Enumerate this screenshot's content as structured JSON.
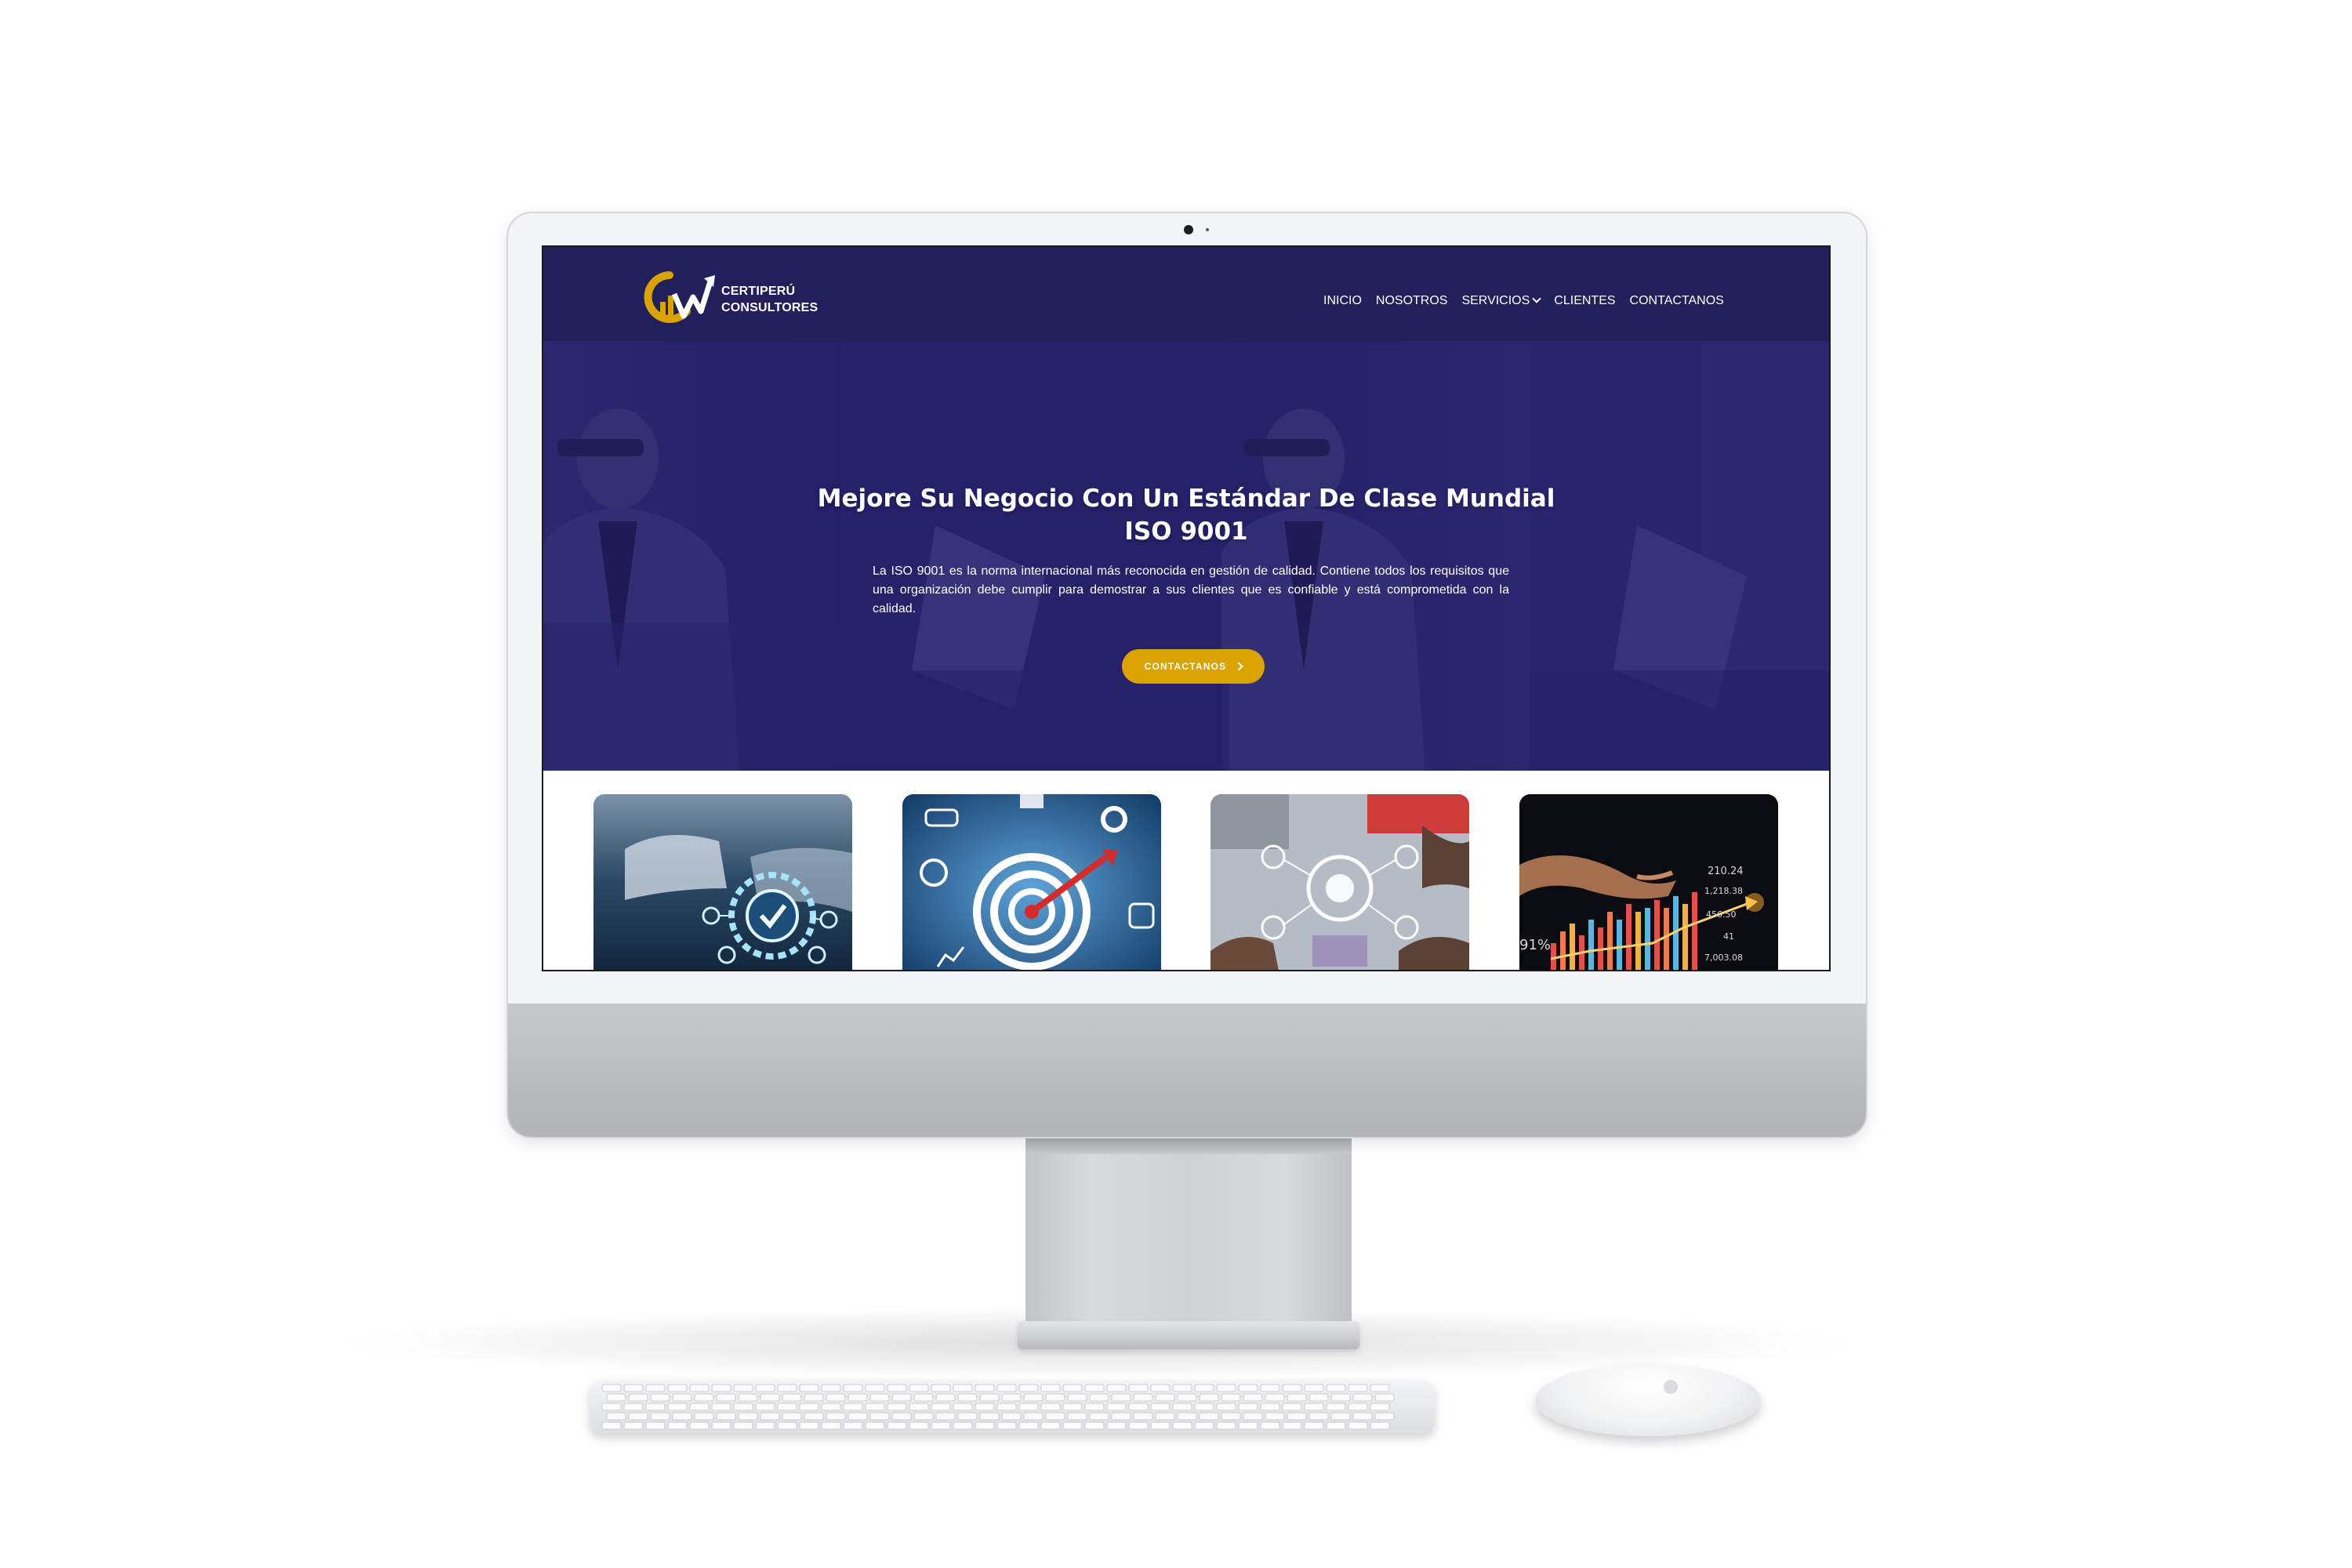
{
  "site": {
    "logo_line1": "CERTIPERÚ",
    "logo_line2": "CONSULTORES",
    "logo_icon": "growth-chart-logo-icon",
    "nav": {
      "inicio": "INICIO",
      "nosotros": "NOSOTROS",
      "servicios": "SERVICIOS",
      "clientes": "CLIENTES",
      "contactanos": "CONTACTANOS"
    },
    "hero": {
      "title_line1": "Mejore Su Negocio Con Un Estándar De Clase Mundial",
      "title_line2": "ISO 9001",
      "paragraph": "La ISO 9001 es la norma internacional más reconocida en gestión de calidad. Contiene todos los requisitos que una organización debe cumplir para demostrar a sus clientes que es confiable y está comprometida con la calidad.",
      "button_label": "CONTACTANOS"
    },
    "cards": [
      {
        "icon": "quality-certification-icon"
      },
      {
        "icon": "target-dart-icon"
      },
      {
        "icon": "business-network-icon"
      },
      {
        "icon": "financial-growth-chart-icon"
      }
    ],
    "card_chart_labels": [
      "210.24",
      "1,218.38",
      "456.50",
      "41",
      "7,003.08",
      "91%"
    ]
  },
  "colors": {
    "header_bg": "#231f5b",
    "accent_gold": "#d9a302",
    "hero_overlay": "#211b69"
  }
}
